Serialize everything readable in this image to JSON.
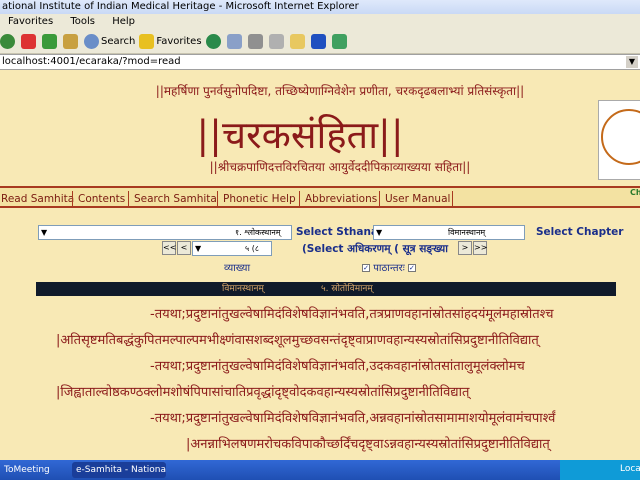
{
  "window": {
    "title": "ational Institute of Indian Medical Heritage - Microsoft Internet Explorer"
  },
  "menu": {
    "items": [
      "Favorites",
      "Tools",
      "Help"
    ]
  },
  "toolbar": {
    "search_label": "Search",
    "favorites_label": "Favorites"
  },
  "address": {
    "url": "localhost:4001/ecaraka/?mod=read"
  },
  "header": {
    "line1": "||महर्षिणा पुनर्वसुनोपदिष्टा, तच्छिष्येणाग्निवेशेन प्रणीता, चरकदृढबलाभ्यां प्रतिसंस्कृता||",
    "title": "||चरकसंहिता||",
    "line3": "||श्रीचक्रपाणिदत्तविरचितया आयुर्वेददीपिकाव्याख्यया सहिता||"
  },
  "nav": {
    "items": [
      "Read Samhita",
      "Contents",
      "Search Samhita",
      "Phonetic Help",
      "Abbreviations",
      "User Manual"
    ],
    "side_text": "Ch"
  },
  "controls": {
    "sthana_value": "१. श्लोकस्थानम्",
    "select_sthana": "Select Sthana",
    "chapter_value": "विमानस्थानम्",
    "select_chapter": "Select Chapter",
    "adhikarana_value": "५ (८",
    "select_adhikarana": "(Select अधिकरणम् ( सूत्र सङ्ख्या",
    "prev_btn": "<<",
    "prev2_btn": "<",
    "next_btn": ">",
    "next2_btn": ">>",
    "vyakhya": "व्याख्या",
    "pathantara": "पाठान्तरः",
    "check_mark": "✓"
  },
  "blackbar": {
    "left": "विमानस्थानम्",
    "right": "५. स्रोतोविमानम्"
  },
  "verses": [
    "-तयथा;प्रदुष्टानांतुखल्वेषामिदंविशेषविज्ञानंभवति,तत्रप्राणवहानांस्रोतसांहदयंमूलंमहास्रोतश्च",
    "|अतिसृष्टमतिबद्धंकुपितमल्पाल्पमभीक्ष्णंवासशब्दशूलमुच्छवसन्तंदृष्ट्वाप्राणवहान्यस्यस्रोतांसिप्रदुष्टानीतिविद्यात्",
    "-तयथा;प्रदुष्टानांतुखल्वेषामिदंविशेषविज्ञानंभवति,उदकवहानांस्रोतसांतालुमूलंक्लोमच",
    "|जिह्वाताल्वोष्ठकण्ठक्लोमशोषंपिपासांचातिप्रवृद्धांदृष्ट्वोदकवहान्यस्यस्रोतांसिप्रदुष्टानीतिविद्यात्",
    "-तयथा;प्रदुष्टानांतुखल्वेषामिदंविशेषविज्ञानंभवति,अन्नवहानांस्रोतसामामाशयोमूलंवामंचपार्श्वं",
    "|अनन्नाभिलषणमरोचकविपाकौच्छर्दिंचदृष्ट्वाऽन्नवहान्यस्यस्रोतांसिप्रदुष्टानीतिविद्यात्"
  ],
  "taskbar": {
    "item1": "ToMeeting",
    "item2": "e-Samhita - National...",
    "tray": "Local"
  }
}
